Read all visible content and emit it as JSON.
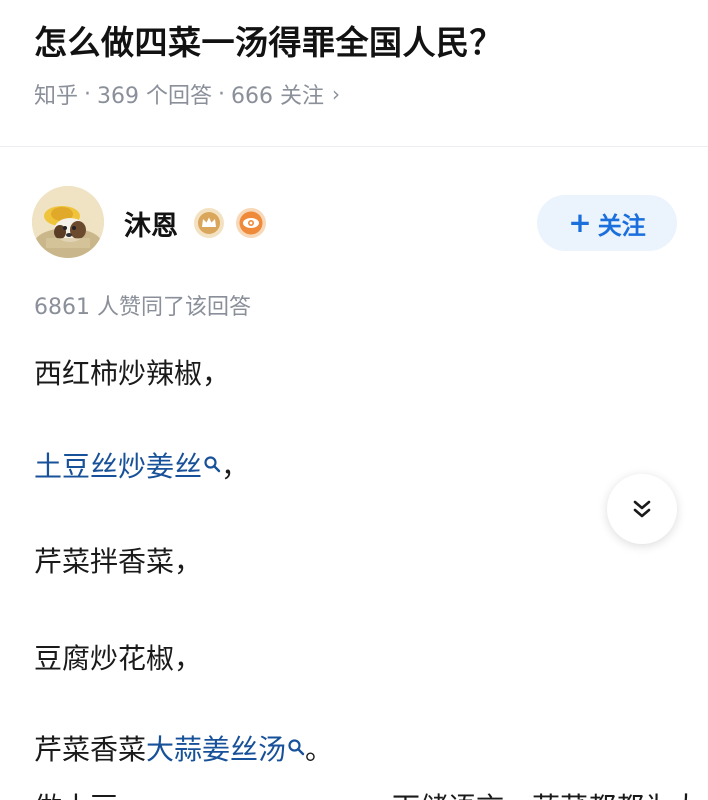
{
  "question": {
    "title": "怎么做四菜一汤得罪全国人民？",
    "source": "知乎",
    "answers": "369 个回答",
    "followers": "666 关注",
    "separator": "·",
    "chevron": "›"
  },
  "author": {
    "name": "沐恩",
    "badges": [
      "crown-badge-icon",
      "eye-badge-icon"
    ],
    "follow_label": "关注",
    "follow_plus": "+"
  },
  "answer": {
    "voters": "6861 人赞同了该回答",
    "lines": [
      {
        "text": "西红柿炒辣椒，"
      },
      {
        "link": "土豆丝炒姜丝",
        "tail": "，"
      },
      {
        "text": "芹菜拌香菜，"
      },
      {
        "text": "豆腐炒花椒，"
      },
      {
        "head": "芹菜香菜",
        "link": "大蒜姜丝汤",
        "tail": "。"
      }
    ],
    "cut_left": "做土豆",
    "cut_right": "下储语言，蔬菜都都为大"
  },
  "colors": {
    "link": "#175199",
    "follow_bg": "#ebf3fd",
    "follow_text": "#1a6fdc",
    "meta": "#8a8f99"
  }
}
